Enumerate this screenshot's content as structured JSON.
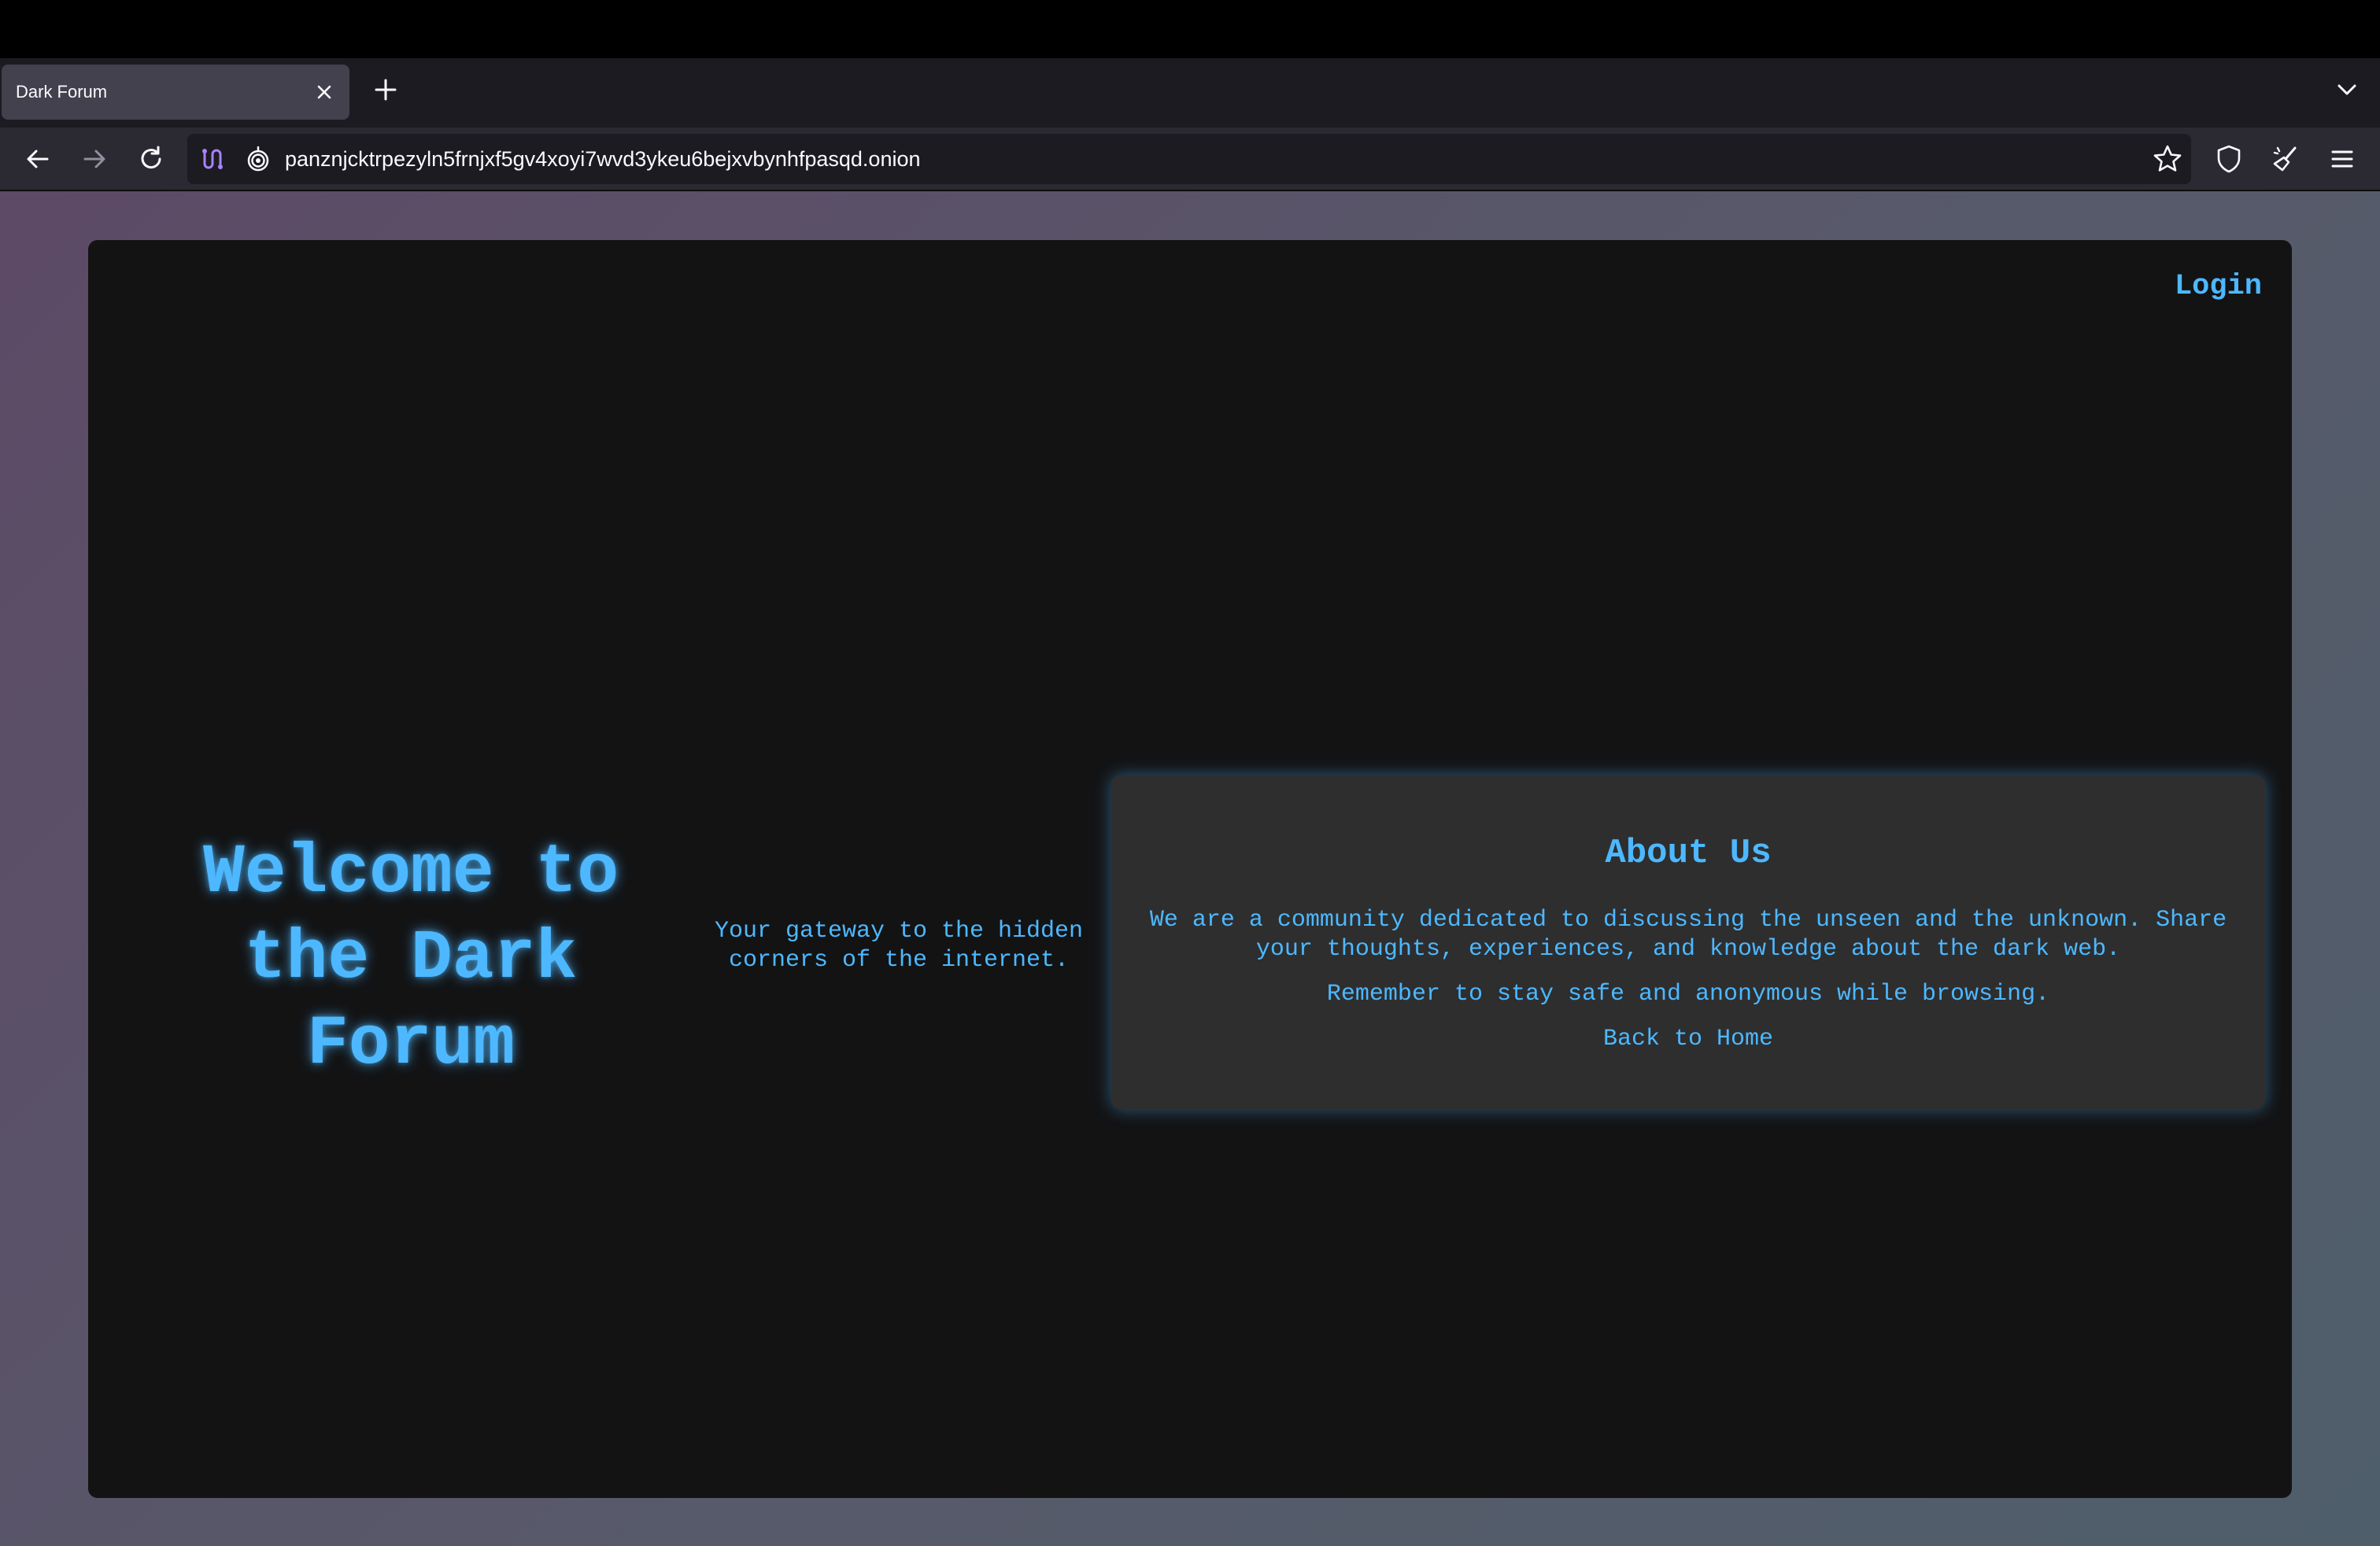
{
  "browser": {
    "tab_title": "Dark Forum",
    "url": "panznjcktrpezyln5frnjxf5gv4xoyi7wvd3ykeu6bejxvbynhfpasqd.onion",
    "icons": {
      "tab_close": "close-icon",
      "new_tab": "plus-icon",
      "tab_list": "chevron-down-icon",
      "back": "back-arrow-icon",
      "forward": "forward-arrow-icon",
      "reload": "reload-icon",
      "tor_circuit": "tor-circuit-icon",
      "onion": "onion-icon",
      "bookmark": "star-icon",
      "shield": "shield-icon",
      "new_identity": "broom-icon",
      "menu": "hamburger-menu-icon"
    }
  },
  "page": {
    "login": "Login",
    "welcome_title": "Welcome to the Dark Forum",
    "tagline": "Your gateway to the hidden corners of the internet.",
    "about": {
      "title": "About Us",
      "paragraph1": "We are a community dedicated to discussing the unseen and the unknown. Share your thoughts, experiences, and knowledge about the dark web.",
      "paragraph2": "Remember to stay safe and anonymous while browsing.",
      "back_link": "Back to Home"
    }
  },
  "colors": {
    "accent": "#4db8ff",
    "page_bg": "#131314",
    "card_bg": "#2e2e2f"
  }
}
